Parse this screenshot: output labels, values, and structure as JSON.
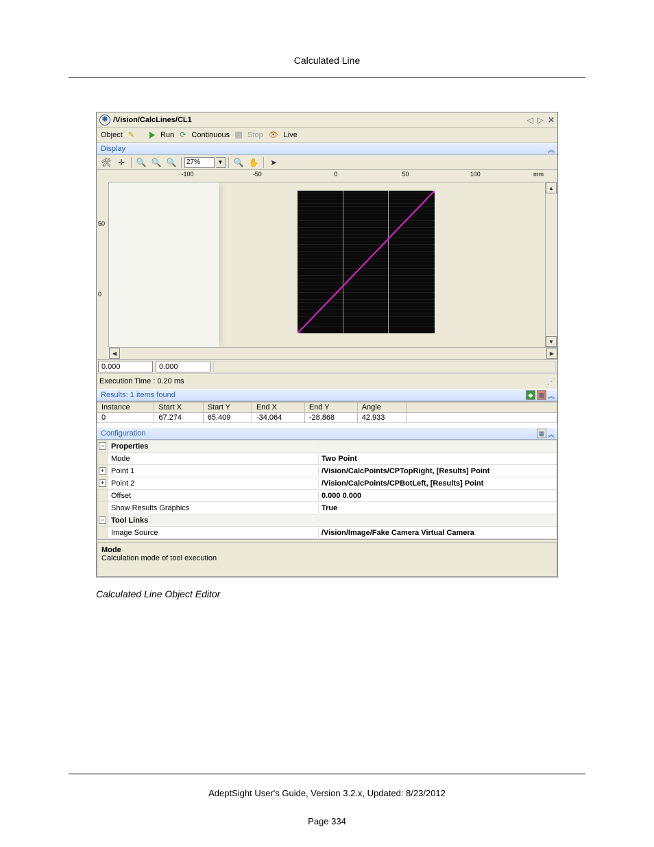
{
  "doc_title": "Calculated Line",
  "titlebar_path": "/Vision/CalcLines/CL1",
  "toolbar1": {
    "object_label": "Object",
    "run_label": "Run",
    "continuous_label": "Continuous",
    "stop_label": "Stop",
    "live_label": "Live"
  },
  "section_display": "Display",
  "zoom_value": "27%",
  "ruler_ticks": [
    "-100",
    "-50",
    "0",
    "50",
    "100"
  ],
  "ruler_unit": "mm",
  "ruler_v": [
    "50",
    "0"
  ],
  "coord_x": "0.000",
  "coord_y": "0.000",
  "exec_time": "Execution Time : 0.20 ms",
  "results_header": "Results: 1 items found",
  "results_cols": [
    "Instance",
    "Start X",
    "Start Y",
    "End X",
    "End Y",
    "Angle"
  ],
  "results_row": [
    "0",
    "67.274",
    "65.409",
    "-34.064",
    "-28.868",
    "42.933"
  ],
  "section_config": "Configuration",
  "props": {
    "group_props": "Properties",
    "mode_label": "Mode",
    "mode_value": "Two Point",
    "point1_label": "Point 1",
    "point1_value": "/Vision/CalcPoints/CPTopRight, [Results] Point",
    "point2_label": "Point 2",
    "point2_value": "/Vision/CalcPoints/CPBotLeft, [Results] Point",
    "offset_label": "Offset",
    "offset_value": "0.000 0.000",
    "show_label": "Show Results Graphics",
    "show_value": "True",
    "group_tool": "Tool Links",
    "imgsrc_label": "Image Source",
    "imgsrc_value": "/Vision/Image/Fake Camera Virtual Camera"
  },
  "desc_title": "Mode",
  "desc_text": "Calculation mode of tool execution",
  "caption": "Calculated Line Object Editor",
  "footer_text": "AdeptSight User's Guide,  Version 3.2.x, Updated: 8/23/2012",
  "page_number": "Page 334"
}
